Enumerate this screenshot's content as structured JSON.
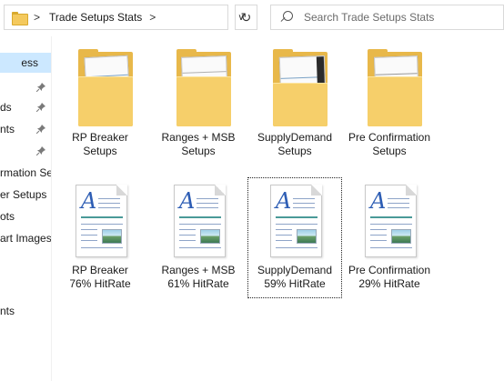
{
  "addressbar": {
    "separator": ">",
    "breadcrumb": "Trade Setups Stats",
    "dropdown_glyph": "∨",
    "refresh_glyph": "↻",
    "search_placeholder": "Search Trade Setups Stats"
  },
  "nav": {
    "items": [
      {
        "label": "ess",
        "selected": true,
        "pinned": false
      },
      {
        "label": "",
        "selected": false,
        "pinned": true
      },
      {
        "label": "ds",
        "selected": false,
        "pinned": true
      },
      {
        "label": "nts",
        "selected": false,
        "pinned": true
      },
      {
        "label": "",
        "selected": false,
        "pinned": true
      },
      {
        "label": "rmation Se",
        "selected": false,
        "pinned": false
      },
      {
        "label": "er   Setups",
        "selected": false,
        "pinned": false
      },
      {
        "label": "ots",
        "selected": false,
        "pinned": false
      },
      {
        "label": "art Images",
        "selected": false,
        "pinned": false
      },
      {
        "label": "nts",
        "selected": false,
        "pinned": false
      }
    ]
  },
  "folders": [
    {
      "line1": "RP Breaker",
      "line2": "Setups"
    },
    {
      "line1": "Ranges + MSB",
      "line2": "Setups"
    },
    {
      "line1": "SupplyDemand",
      "line2": "Setups"
    },
    {
      "line1": "Pre Confirmation",
      "line2": "Setups"
    }
  ],
  "files": [
    {
      "line1": "RP Breaker",
      "line2": "76% HitRate",
      "icon_letter": "A"
    },
    {
      "line1": "Ranges + MSB",
      "line2": "61% HitRate",
      "icon_letter": "A"
    },
    {
      "line1": "SupplyDemand",
      "line2": "59% HitRate",
      "icon_letter": "A",
      "focused": true
    },
    {
      "line1": "Pre Confirmation",
      "line2": "29% HitRate",
      "icon_letter": "A"
    }
  ],
  "colors": {
    "selection": "#cce8ff",
    "folder": "#f6cf6a",
    "doc_accent": "#2d5db4"
  }
}
